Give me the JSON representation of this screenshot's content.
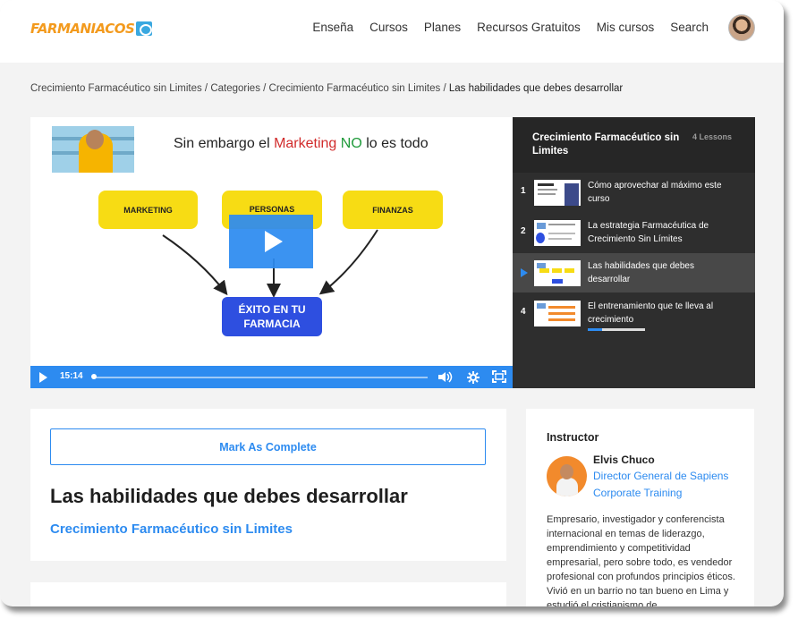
{
  "header": {
    "logo_text": "FARMANIACOS",
    "nav": [
      "Enseña",
      "Cursos",
      "Planes",
      "Recursos Gratuitos",
      "Mis cursos",
      "Search"
    ]
  },
  "breadcrumb": {
    "items": [
      "Crecimiento Farmacéutico sin Limites",
      "Categories",
      "Crecimiento Farmacéutico sin Limites"
    ],
    "separator": " / ",
    "current": "Las habilidades que debes desarrollar"
  },
  "video": {
    "slide_title_a": "Sin embargo el ",
    "slide_title_b": "Marketing",
    "slide_title_c": " NO",
    "slide_title_d": " lo es todo",
    "box_1": "MARKETING",
    "box_2": "PERSONAS",
    "box_3": "FINANZAS",
    "result_line_1": "ÉXITO EN TU",
    "result_line_2": "FARMACIA",
    "time": "15:14",
    "accent": "#2d8bf0"
  },
  "playlist": {
    "title": "Crecimiento Farmacéutico sin Limites",
    "count": "4 Lessons",
    "items": [
      {
        "num": "1",
        "label": "Cómo aprovechar al máximo este curso"
      },
      {
        "num": "2",
        "label": "La estrategia Farmacéutica de Crecimiento Sin Límites"
      },
      {
        "num": "",
        "label": "Las habilidades que debes desarrollar"
      },
      {
        "num": "4",
        "label": "El entrenamiento que te lleva al crecimiento",
        "progress": 0.25
      }
    ]
  },
  "main": {
    "mark_complete": "Mark As Complete",
    "lesson_title": "Las habilidades que debes desarrollar",
    "course_link": "Crecimiento Farmacéutico sin Limites"
  },
  "instructor": {
    "heading": "Instructor",
    "name": "Elvis Chuco",
    "role": "Director General de Sapiens Corporate Training",
    "bio": "Empresario, investigador y conferencista internacional en temas de liderazgo, emprendimiento y competitividad empresarial, pero sobre todo, es vendedor profesional con profundos principios éticos. Vivió en un barrio no tan bueno en Lima y estudió el cristianismo de..."
  }
}
